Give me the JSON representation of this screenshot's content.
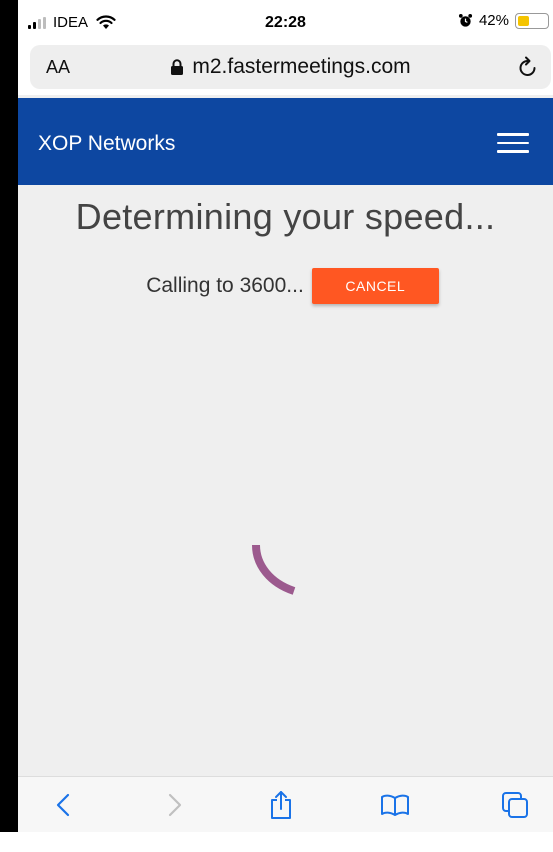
{
  "status_bar": {
    "carrier": "IDEA",
    "time": "22:28",
    "battery_percent": "42%",
    "battery_level": 0.42
  },
  "address_bar": {
    "text_size_label": "AA",
    "url": "m2.fastermeetings.com"
  },
  "header": {
    "brand": "XOP Networks"
  },
  "main": {
    "heading": "Determining your speed...",
    "calling_text": "Calling to 3600...",
    "cancel_label": "CANCEL"
  },
  "colors": {
    "header_bg": "#0d47a1",
    "cancel_bg": "#ff5722",
    "spinner": "#9c5a8e",
    "accent_blue": "#1a73e8"
  },
  "icons": {
    "signal": "signal-icon",
    "wifi": "wifi-icon",
    "alarm": "alarm-icon",
    "lock": "lock-icon",
    "reload": "reload-icon",
    "menu": "hamburger-menu-icon",
    "back": "back-icon",
    "forward": "forward-icon",
    "share": "share-icon",
    "bookmarks": "bookmarks-icon",
    "tabs": "tabs-icon"
  }
}
